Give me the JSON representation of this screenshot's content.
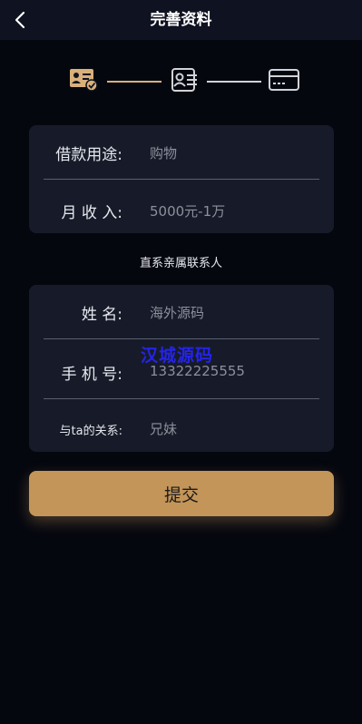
{
  "header": {
    "title": "完善资料",
    "back_icon": "chevron-left-icon"
  },
  "steps": {
    "icons": [
      "id-card-check-icon",
      "contact-list-icon",
      "bank-card-icon"
    ],
    "active_color": "#d9b07a",
    "inactive_color": "#d0d3da"
  },
  "loan_card": {
    "purpose_label": "借款用途:",
    "purpose_value": "购物",
    "income_label": "月 收 入:",
    "income_value": "5000元-1万"
  },
  "contact_section_title": "直系亲属联系人",
  "contact_card": {
    "name_label": "姓 名:",
    "name_value": "海外源码",
    "phone_label": "手 机 号:",
    "phone_value": "13322225555",
    "relation_label": "与ta的关系:",
    "relation_value": "兄妹"
  },
  "watermark": "汉城源码",
  "submit_label": "提交",
  "colors": {
    "accent": "#c39559",
    "background": "#05070f",
    "card": "#171b29"
  }
}
